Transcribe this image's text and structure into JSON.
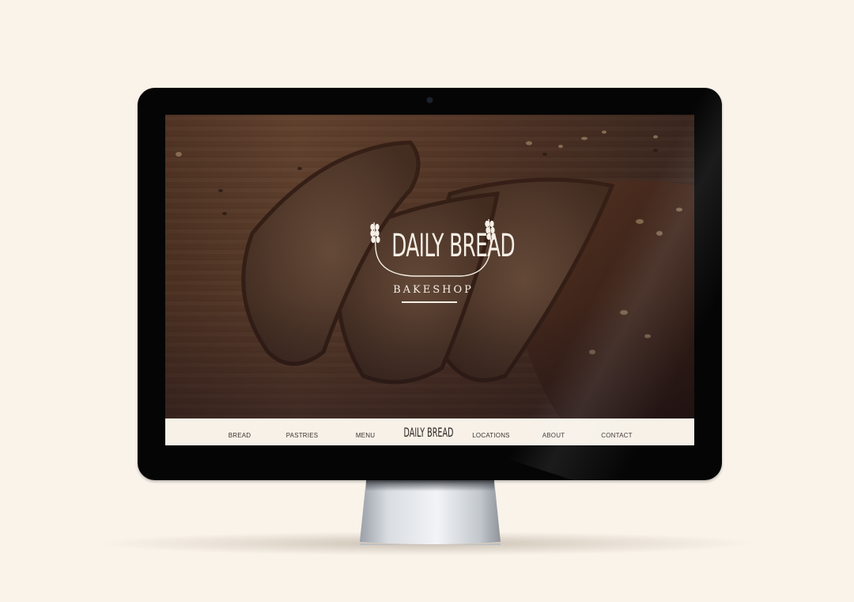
{
  "hero": {
    "logo_title": "DAILY BREAD",
    "logo_subtitle": "BAKESHOP"
  },
  "nav": {
    "items": [
      {
        "label": "BREAD"
      },
      {
        "label": "PASTRIES"
      },
      {
        "label": "MENU"
      },
      {
        "label": "LOCATIONS"
      },
      {
        "label": "ABOUT"
      },
      {
        "label": "CONTACT"
      }
    ],
    "logo": "DAILY BREAD"
  },
  "colors": {
    "background": "#f9f3ea",
    "bezel": "#050505",
    "navbar": "#f7f1e8",
    "logo_text": "#f6efe6",
    "nav_text": "#3b3330"
  },
  "icons": [
    "wheat-icon",
    "webcam-icon"
  ]
}
